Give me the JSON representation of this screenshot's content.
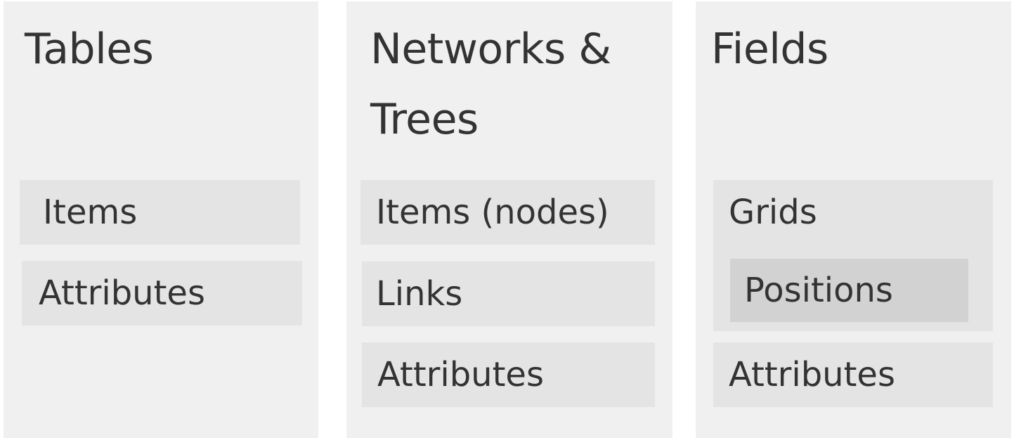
{
  "columns": {
    "tables": {
      "title": "Tables",
      "items": [
        "Items",
        "Attributes"
      ]
    },
    "networks": {
      "title_line1": "Networks &",
      "title_line2": "Trees",
      "items": [
        "Items (nodes)",
        "Links",
        "Attributes"
      ]
    },
    "fields": {
      "title": "Fields",
      "grids": {
        "label": "Grids",
        "inner": "Positions"
      },
      "items": [
        "Attributes"
      ]
    }
  },
  "colors": {
    "column_bg": "#f0f0f0",
    "box_bg": "#e4e4e4",
    "inner_box_bg": "#d2d2d2",
    "text": "#333333"
  }
}
